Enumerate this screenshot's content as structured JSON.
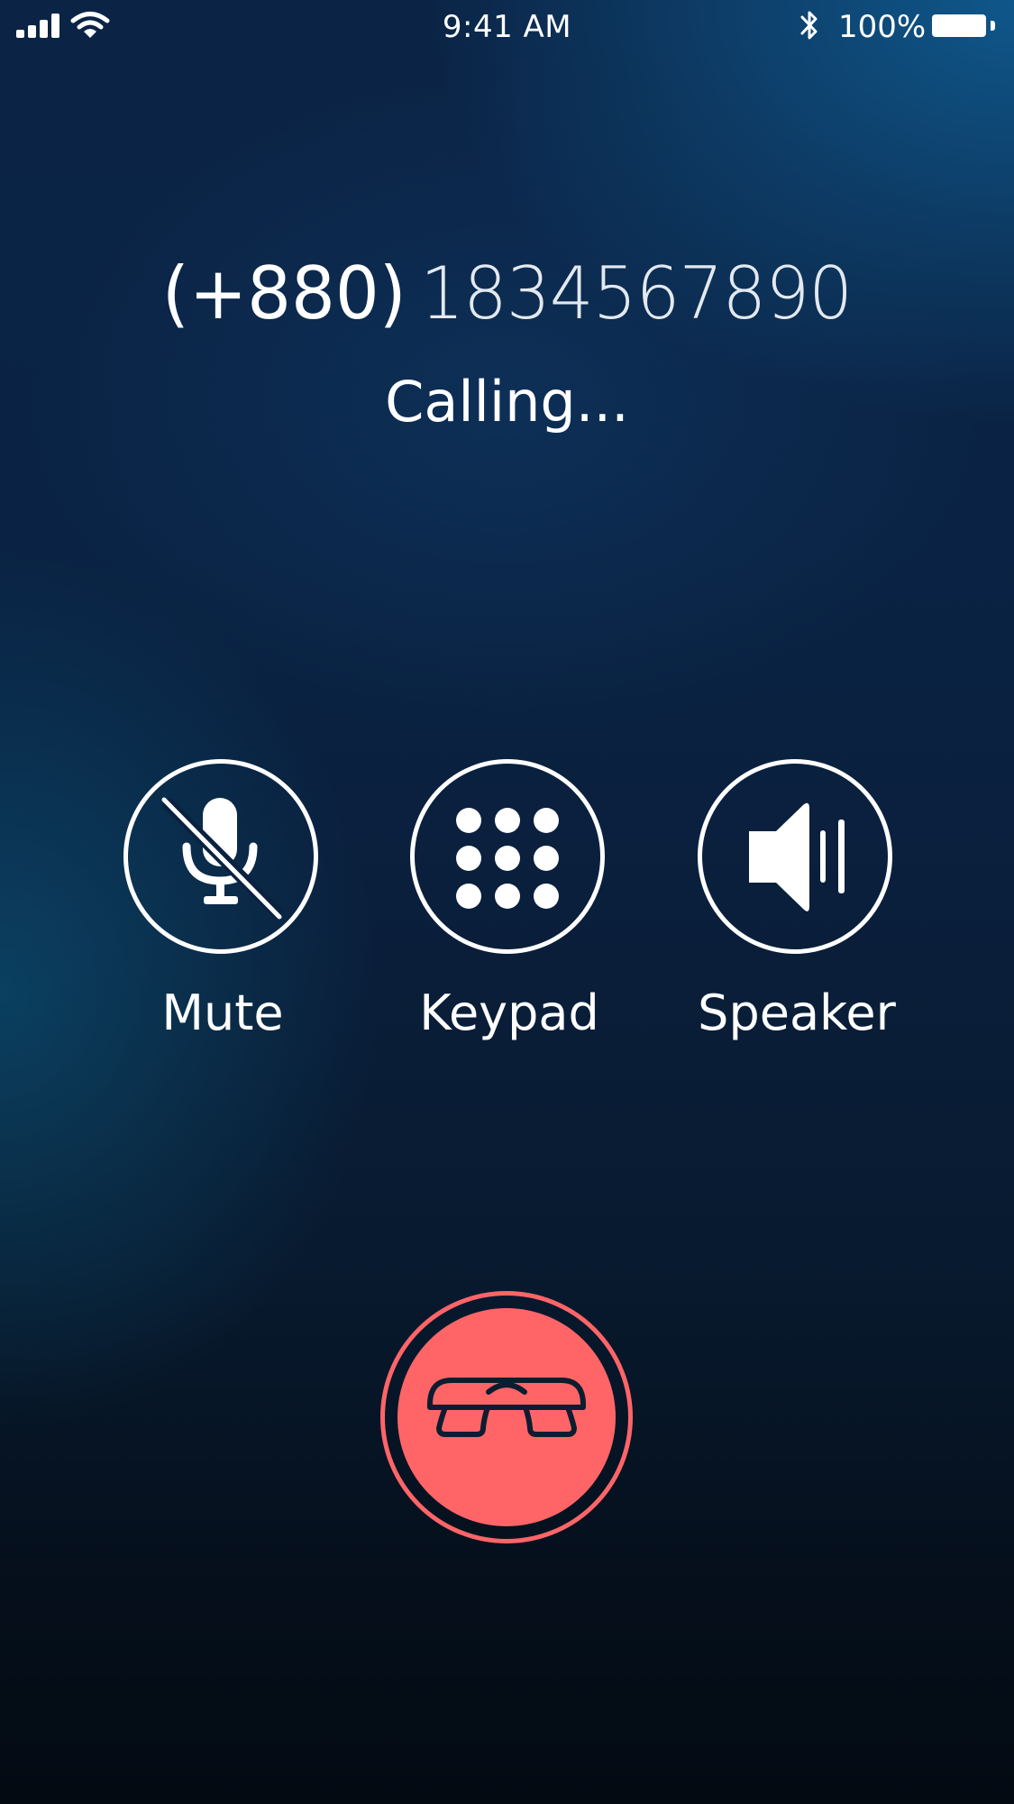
{
  "status_bar": {
    "time": "9:41 AM",
    "battery_percent": "100%",
    "battery_level": 1.0,
    "icons": [
      "signal-icon",
      "wifi-icon",
      "bluetooth-icon",
      "battery-icon"
    ]
  },
  "call": {
    "country_code": "(+880)",
    "number": "1834567890",
    "status": "Calling..."
  },
  "actions": [
    {
      "label": "Mute",
      "icon": "mic-off-icon"
    },
    {
      "label": "Keypad",
      "icon": "keypad-icon"
    },
    {
      "label": "Speaker",
      "icon": "speaker-icon"
    }
  ],
  "end_call": {
    "icon": "hang-up-icon"
  },
  "colors": {
    "end_call": "#ff6567",
    "foreground": "#ffffff",
    "background_top": "#0b2446",
    "background_bottom": "#030a12"
  }
}
